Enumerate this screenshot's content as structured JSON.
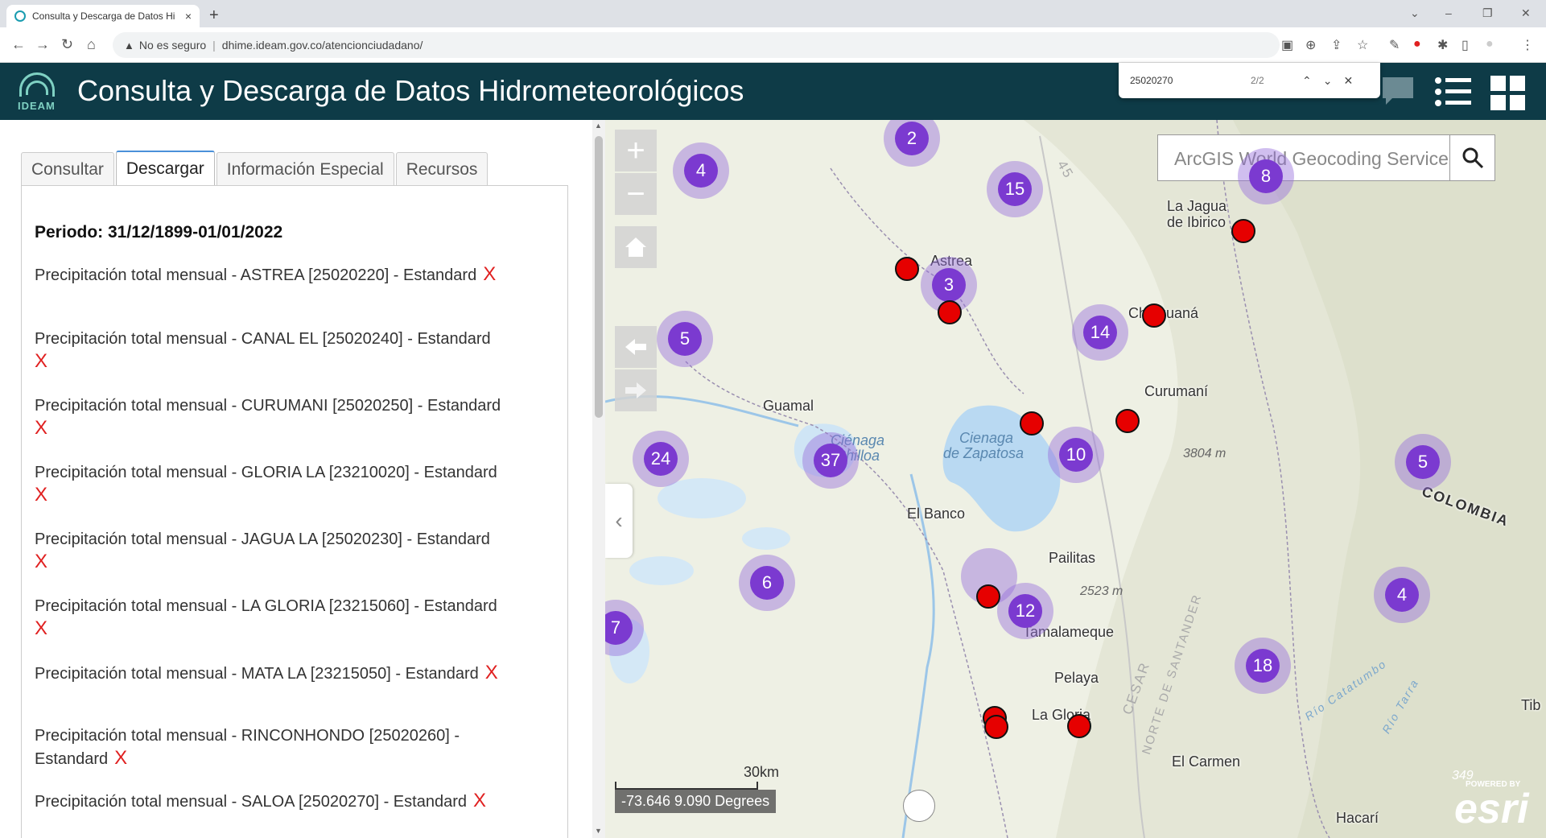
{
  "browser": {
    "tab_title": "Consulta y Descarga de Datos Hi",
    "tab_close": "×",
    "new_tab": "+",
    "win_minimize": "–",
    "win_restore": "❐",
    "win_close": "✕",
    "tab_search": "⌄",
    "security_label": "No es seguro",
    "url": "dhime.ideam.gov.co/atencionciudadano/"
  },
  "find_bar": {
    "query": "25020270",
    "count": "2/2",
    "prev": "⌃",
    "next": "⌄",
    "close": "✕"
  },
  "app": {
    "logo_text": "IDEAM",
    "title": "Consulta y Descarga de Datos Hidrometeorológicos"
  },
  "panel": {
    "tabs": [
      "Consultar",
      "Descargar",
      "Información Especial",
      "Recursos"
    ],
    "active_tab": "Descargar",
    "periodo": "Periodo: 31/12/1899-01/01/2022",
    "remove_mark": "X",
    "items": [
      "Precipitación total mensual - ASTREA [25020220] - Estandard",
      "Precipitación total mensual - CANAL EL [25020240] - Estandard",
      "Precipitación total mensual - CURUMANI [25020250] - Estandard",
      "Precipitación total mensual - GLORIA LA [23210020] - Estandard",
      "Precipitación total mensual - JAGUA LA [25020230] - Estandard",
      "Precipitación total mensual - LA GLORIA [23215060] - Estandard",
      "Precipitación total mensual - MATA LA [23215050] - Estandard",
      "Precipitación total mensual - RINCONHONDO [25020260] - Estandard",
      "Precipitación total mensual - SALOA [25020270] - Estandard"
    ]
  },
  "map": {
    "search_placeholder": "ArcGIS World Geocoding Service",
    "zoom_in": "+",
    "zoom_out": "−",
    "scale_label": "30km",
    "coords": "-73.646 9.090 Degrees",
    "esri_powered": "POWERED BY",
    "esri_wordmark": "esri",
    "clusters": [
      "2",
      "4",
      "15",
      "8",
      "3",
      "5",
      "14",
      "24",
      "37",
      "10",
      "5",
      "6",
      "12",
      "4",
      "7",
      "18"
    ],
    "places": [
      "Astrea",
      "La Jagua",
      "de Ibirico",
      "Chiriguaná",
      "Curumaní",
      "Guamal",
      "El Banco",
      "Pailitas",
      "Tamalameque",
      "Pelaya",
      "La Gloria",
      "El Carmen",
      "Hacarí",
      "Tib",
      "COLOMBIA"
    ],
    "water": [
      "Ciénaga",
      "Chilloa",
      "Cienaga",
      "de Zapatosa"
    ],
    "elevations": [
      "3804 m",
      "2523 m",
      "349"
    ],
    "roads": [
      "45",
      "CESAR",
      "NORTE DE SANTANDER",
      "Río Catatumbo",
      "Río Tarra"
    ]
  }
}
